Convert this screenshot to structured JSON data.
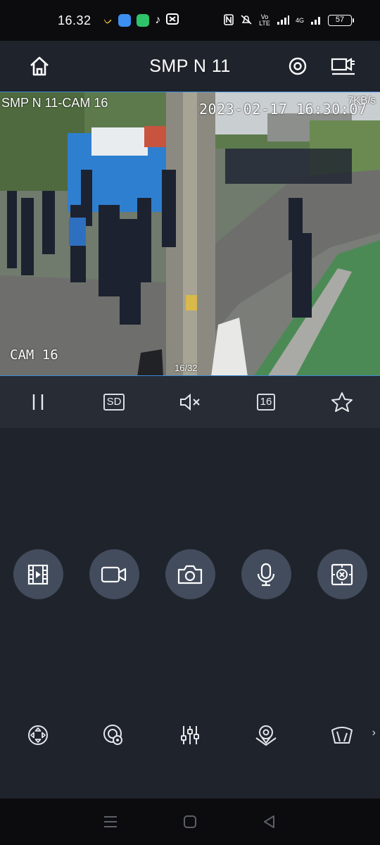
{
  "status_bar": {
    "time": "16.32",
    "network": "4G",
    "volte": "Vo LTE",
    "battery": "57"
  },
  "header": {
    "title": "SMP N 11"
  },
  "video": {
    "camera_name": "SMP N 11-CAM 16",
    "timestamp": "2023-02-17 16:30:07",
    "bitrate": "7KB/s",
    "channel_label": "CAM 16",
    "page_indicator": "16/32"
  },
  "controls": {
    "stream_quality": "SD",
    "channel_number": "16"
  },
  "icons": {
    "header": [
      "home-icon",
      "settings-icon",
      "multi-view-icon"
    ],
    "controls": [
      "pause-icon",
      "stream-quality-icon",
      "mute-icon",
      "channel-icon",
      "favorite-icon"
    ],
    "actions": [
      "playback-icon",
      "record-icon",
      "snapshot-icon",
      "microphone-icon",
      "digital-zoom-icon"
    ],
    "ptz": [
      "ptz-direction-icon",
      "focus-icon",
      "image-adjust-icon",
      "preset-icon",
      "wiper-icon"
    ],
    "nav": [
      "menu-icon",
      "home-square-icon",
      "back-icon"
    ]
  },
  "colors": {
    "background": "#1f232b",
    "controls_bar": "#272c35",
    "action_button": "#424c5c",
    "video_border": "#3a8bd8"
  }
}
